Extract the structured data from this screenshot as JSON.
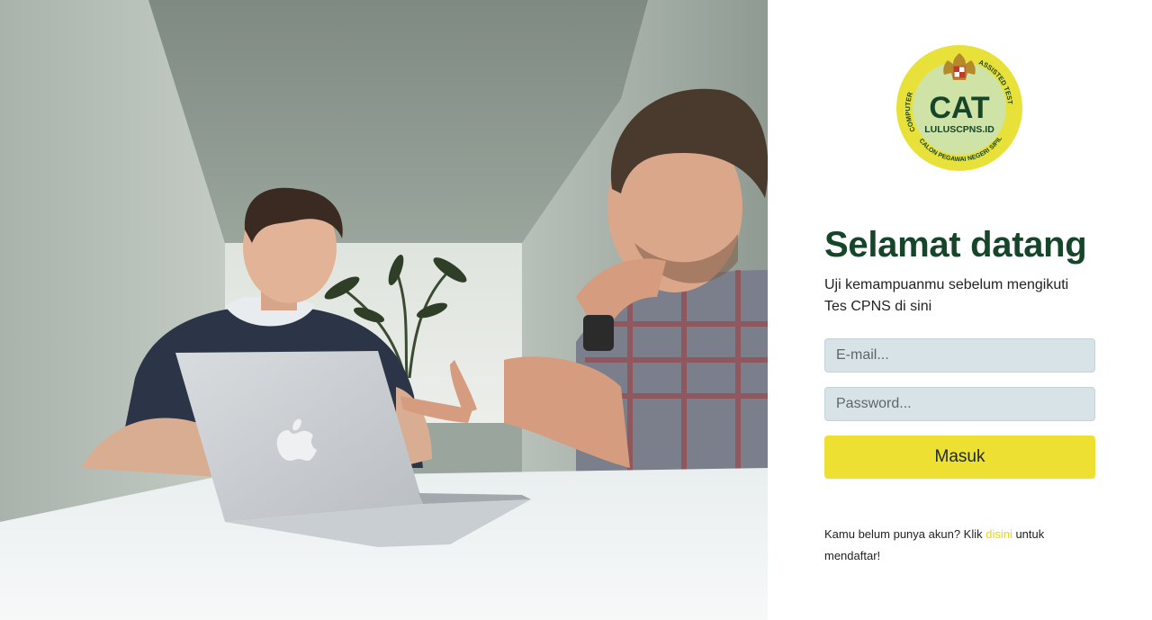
{
  "logo": {
    "main_text": "CAT",
    "site_text": "LULUSCPNS.ID",
    "arc_left_text": "COMPUTER",
    "arc_right_text": "ASSISTED TEST",
    "arc_bottom_text": "CALON PEGAWAI NEGERI SIPIL",
    "colors": {
      "ring": "#e8e13a",
      "inner": "#cfe3a6",
      "text": "#17452a"
    }
  },
  "login": {
    "heading": "Selamat datang",
    "subheading": "Uji kemampuanmu sebelum mengikuti Tes CPNS di sini",
    "email_placeholder": "E-mail...",
    "password_placeholder": "Password...",
    "submit_label": "Masuk",
    "register_prefix": "Kamu belum punya akun? Klik ",
    "register_link": "disini",
    "register_suffix": " untuk mendaftar!"
  },
  "colors": {
    "heading": "#17452a",
    "button": "#ede033",
    "link": "#e6d41a",
    "input_bg": "#d8e3e8"
  }
}
